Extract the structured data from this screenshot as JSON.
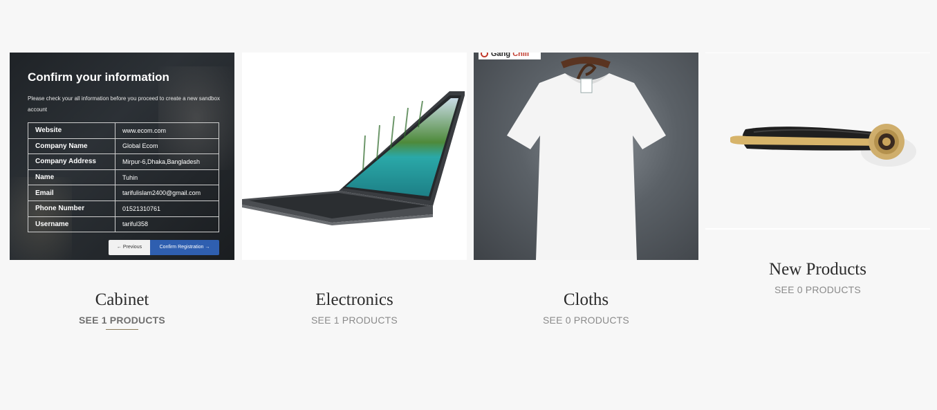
{
  "categories": [
    {
      "name": "Cabinet",
      "link": "SEE 1 PRODUCTS",
      "image_icon": "registration-screenshot",
      "screenshot": {
        "heading": "Confirm your information",
        "description": "Please check your all information before you proceed to create a new sandbox account",
        "rows": [
          {
            "key": "Website",
            "value": "www.ecom.com"
          },
          {
            "key": "Company Name",
            "value": "Global Ecom"
          },
          {
            "key": "Company Address",
            "value": "Mirpur-6,Dhaka,Bangladesh"
          },
          {
            "key": "Name",
            "value": "Tuhin"
          },
          {
            "key": "Email",
            "value": "tarifulislam2400@gmail.com"
          },
          {
            "key": "Phone Number",
            "value": "01521310761"
          },
          {
            "key": "Username",
            "value": "tariful358"
          }
        ],
        "prev_label": "← Previous",
        "confirm_label": "Confirm Registration →"
      }
    },
    {
      "name": "Electronics",
      "link": "SEE 1 PRODUCTS",
      "image_icon": "laptop-image"
    },
    {
      "name": "Cloths",
      "link": "SEE 0 PRODUCTS",
      "image_icon": "tshirt-image",
      "brand_text_a": "Gang",
      "brand_text_b": "Chili"
    },
    {
      "name": "New Products",
      "link": "SEE 0 PRODUCTS",
      "image_icon": "door-handle-image"
    }
  ],
  "colors": {
    "background": "#f7f7f7",
    "title": "#2b2b2b",
    "link": "#8a8a8a",
    "confirm_button": "#2f5fb0"
  }
}
